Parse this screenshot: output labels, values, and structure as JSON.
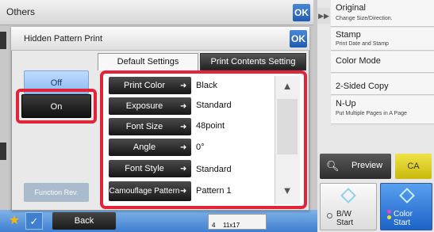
{
  "background_panel": {
    "title": "Others",
    "ok_label": "OK"
  },
  "dialog": {
    "title": "Hidden Pattern Print",
    "ok_label": "OK",
    "tabs": [
      {
        "label": "Default Settings",
        "selected": true
      },
      {
        "label": "Print Contents Setting",
        "selected": false
      }
    ],
    "off_label": "Off",
    "on_label": "On",
    "function_review_label": "Function Rev.",
    "settings": [
      {
        "label": "Print Color",
        "value": "Black"
      },
      {
        "label": "Exposure",
        "value": "Standard"
      },
      {
        "label": "Font Size",
        "value": "48point"
      },
      {
        "label": "Angle",
        "value": "0°"
      },
      {
        "label": "Font Style",
        "value": "Standard"
      },
      {
        "label": "Camouflage Pattern",
        "value": "Pattern 1"
      }
    ],
    "scroll_up_icon": "double-up-arrow",
    "scroll_down_icon": "double-down-arrow"
  },
  "sidebar": {
    "items": [
      {
        "label": "Original",
        "sub": "Change Size/Direction."
      },
      {
        "label": "Stamp",
        "sub": "Print Date and Stamp"
      },
      {
        "label": "Color Mode",
        "sub": ""
      },
      {
        "label": "2-Sided Copy",
        "sub": ""
      },
      {
        "label": "N-Up",
        "sub": "Put Multiple Pages in A Page"
      }
    ],
    "preview_label": "Preview",
    "ca_label": "CA",
    "bw_start": {
      "line1": "B/W",
      "line2": "Start"
    },
    "color_start": {
      "line1": "Color",
      "line2": "Start"
    }
  },
  "bottom_bar": {
    "back_label": "Back",
    "paper_count": "4",
    "paper_size": "11x17"
  },
  "colors": {
    "highlight": "#e2233a",
    "accent_blue": "#1f5bb0",
    "ca_yellow": "#e0cf1e"
  }
}
